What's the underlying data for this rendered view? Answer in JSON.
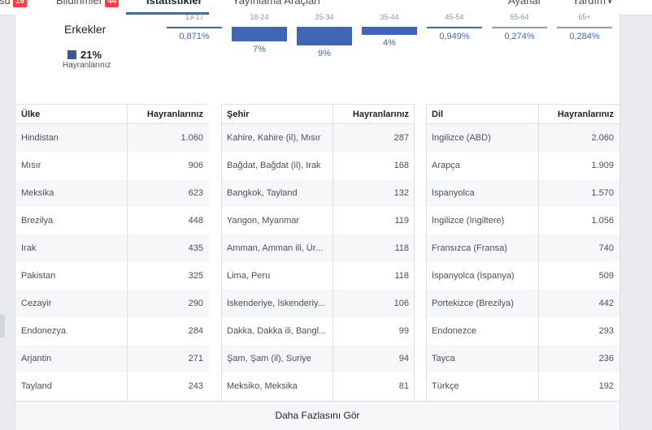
{
  "nav": {
    "items": [
      {
        "label": "su",
        "badge": "16"
      },
      {
        "label": "Bildirimler",
        "badge": "44"
      },
      {
        "label": "İstatistikler"
      },
      {
        "label": "Yayınlama Araçları"
      },
      {
        "label": "Ayarlar"
      },
      {
        "label": "Yardım",
        "caret": "▾"
      }
    ]
  },
  "gender": {
    "title": "Erkekler",
    "percent": "21%",
    "sublabel": "Hayranlarınız",
    "color": "#365899"
  },
  "age_groups": [
    {
      "range": "13-17",
      "percent": "0,871%",
      "value": 0.871
    },
    {
      "range": "18-24",
      "percent": "7%",
      "value": 7
    },
    {
      "range": "25-34",
      "percent": "9%",
      "value": 9
    },
    {
      "range": "35-44",
      "percent": "4%",
      "value": 4
    },
    {
      "range": "45-54",
      "percent": "0,949%",
      "value": 0.949
    },
    {
      "range": "55-64",
      "percent": "0,274%",
      "value": 0.274
    },
    {
      "range": "65+",
      "percent": "0,284%",
      "value": 0.284
    }
  ],
  "tables": {
    "countries": {
      "header": {
        "name": "Ülke",
        "value": "Hayranlarınız"
      },
      "rows": [
        {
          "name": "Hindistan",
          "value": "1.060"
        },
        {
          "name": "Mısır",
          "value": "906"
        },
        {
          "name": "Meksika",
          "value": "623"
        },
        {
          "name": "Brezilya",
          "value": "448"
        },
        {
          "name": "Irak",
          "value": "435"
        },
        {
          "name": "Pakistan",
          "value": "325"
        },
        {
          "name": "Cezayir",
          "value": "290"
        },
        {
          "name": "Endonezya",
          "value": "284"
        },
        {
          "name": "Arjantin",
          "value": "271"
        },
        {
          "name": "Tayland",
          "value": "243"
        }
      ]
    },
    "cities": {
      "header": {
        "name": "Şehir",
        "value": "Hayranlarınız"
      },
      "rows": [
        {
          "name": "Kahire, Kahire (il), Mısır",
          "value": "287"
        },
        {
          "name": "Bağdat, Bağdat (il), Irak",
          "value": "168"
        },
        {
          "name": "Bangkok, Tayland",
          "value": "132"
        },
        {
          "name": "Yangon, Myanmar",
          "value": "119"
        },
        {
          "name": "Amman, Amman ili, Ür...",
          "value": "118"
        },
        {
          "name": "Lima, Peru",
          "value": "118"
        },
        {
          "name": "İskenderiye, İskenderiy...",
          "value": "106"
        },
        {
          "name": "Dakka, Dakka ili, Bangl...",
          "value": "99"
        },
        {
          "name": "Şam, Şam (il), Suriye",
          "value": "94"
        },
        {
          "name": "Meksiko, Meksika",
          "value": "81"
        }
      ]
    },
    "languages": {
      "header": {
        "name": "Dil",
        "value": "Hayranlarınız"
      },
      "rows": [
        {
          "name": "İngilizce (ABD)",
          "value": "2.060"
        },
        {
          "name": "Arapça",
          "value": "1.909"
        },
        {
          "name": "İspanyolca",
          "value": "1.570"
        },
        {
          "name": "İngilizce (İngiltere)",
          "value": "1.056"
        },
        {
          "name": "Fransızca (Fransa)",
          "value": "740"
        },
        {
          "name": "İspanyolca (İspanya)",
          "value": "509"
        },
        {
          "name": "Portekizce (Brezilya)",
          "value": "442"
        },
        {
          "name": "Endonezce",
          "value": "293"
        },
        {
          "name": "Tayca",
          "value": "236"
        },
        {
          "name": "Türkçe",
          "value": "192"
        }
      ]
    }
  },
  "see_more_label": "Daha Fazlasını Gör",
  "colors": {
    "accent": "#4267b2",
    "bar": "#4267b2",
    "bar_light": "#8b9dc3"
  }
}
